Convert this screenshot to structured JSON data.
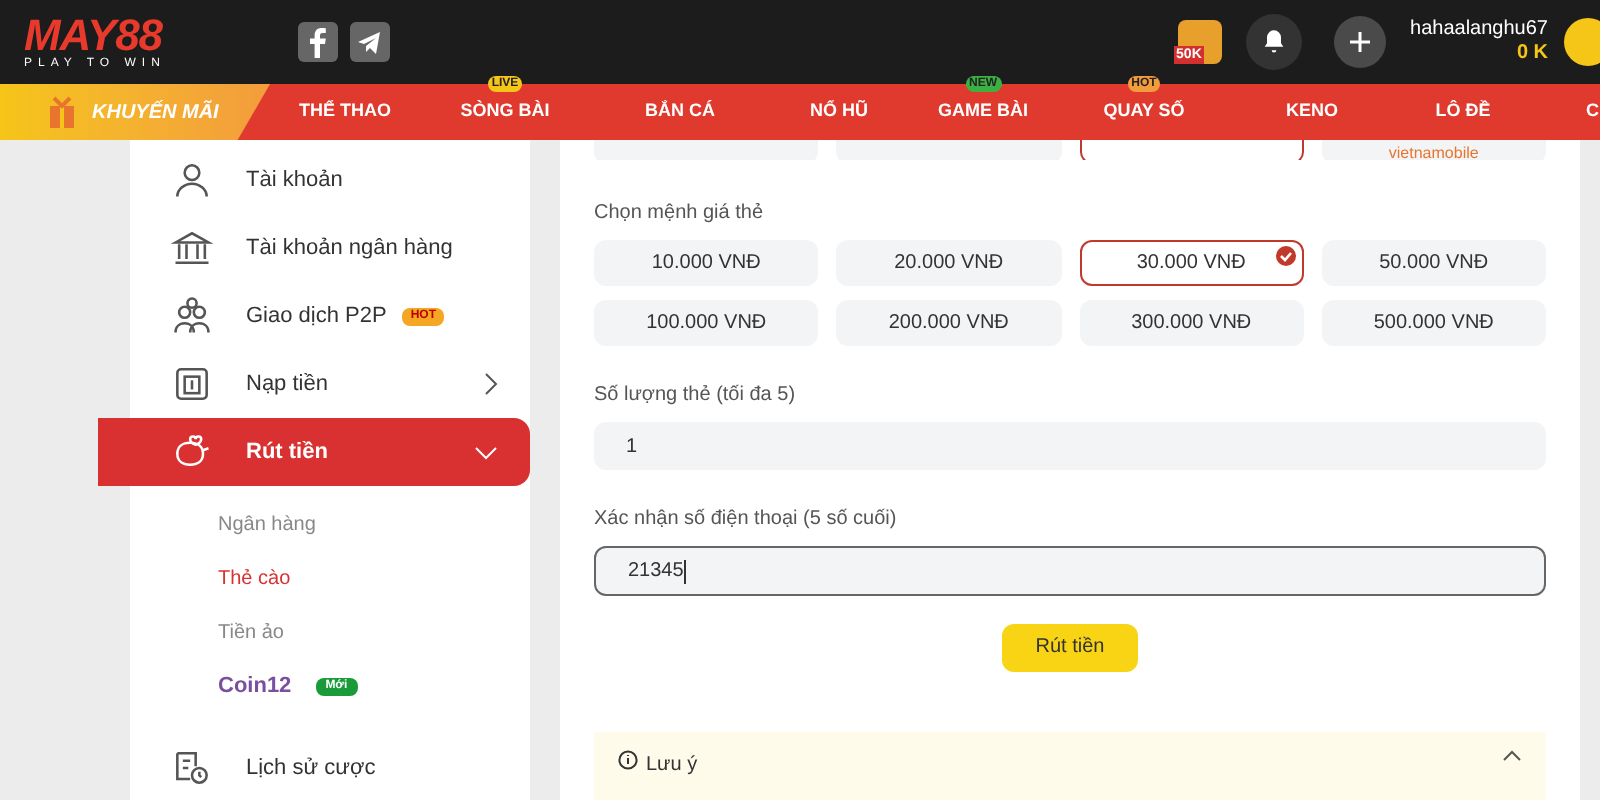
{
  "logo": {
    "name": "MAY88",
    "tagline": "PLAY TO WIN"
  },
  "header": {
    "username": "hahaalanghu67",
    "balance": "0 K",
    "promo_badge": "50K"
  },
  "nav": [
    {
      "label": "KHUYẾN MÃI",
      "kind": "promo"
    },
    {
      "label": "THỂ THAO",
      "kind": "link"
    },
    {
      "label": "SÒNG BÀI",
      "kind": "link",
      "tag": "LIVE",
      "color": "#f5c518"
    },
    {
      "label": "BẮN CÁ",
      "kind": "link"
    },
    {
      "label": "NỔ HŨ",
      "kind": "link"
    },
    {
      "label": "GAME BÀI",
      "kind": "link",
      "tag": "NEW",
      "color": "#3cb043"
    },
    {
      "label": "QUAY SỐ",
      "kind": "link",
      "tag": "HOT",
      "color": "#f39c3c"
    },
    {
      "label": "KENO",
      "kind": "link"
    },
    {
      "label": "LÔ ĐỀ",
      "kind": "link"
    },
    {
      "label": "C",
      "kind": "link"
    }
  ],
  "sidebar": {
    "items": [
      {
        "label": "Tài khoản",
        "selected": false
      },
      {
        "label": "Tài khoản ngân hàng",
        "selected": false
      },
      {
        "label": "Giao dịch P2P",
        "badge": "HOT",
        "selected": false
      },
      {
        "label": "Nạp tiền",
        "expanded": false,
        "selected": false
      },
      {
        "label": "Rút tiền",
        "expanded": true,
        "selected": true,
        "children": [
          {
            "label": "Ngân hàng",
            "selected": false
          },
          {
            "label": "Thẻ cào",
            "selected": true
          },
          {
            "label": "Tiền ảo",
            "selected": false
          },
          {
            "label": "Coin12",
            "badge": "Mới",
            "kind": "brand",
            "selected": false
          }
        ]
      },
      {
        "label": "Lịch sử cược",
        "selected": false
      }
    ]
  },
  "carriers": [
    {
      "selected": false
    },
    {
      "selected": false
    },
    {
      "selected": true
    },
    {
      "label": "vietnamobile",
      "selected": false
    }
  ],
  "denomination": {
    "label": "Chọn mệnh giá thẻ",
    "options": [
      {
        "label": "10.000 VNĐ",
        "selected": false
      },
      {
        "label": "20.000 VNĐ",
        "selected": false
      },
      {
        "label": "30.000 VNĐ",
        "selected": true
      },
      {
        "label": "50.000 VNĐ",
        "selected": false
      },
      {
        "label": "100.000 VNĐ",
        "selected": false
      },
      {
        "label": "200.000 VNĐ",
        "selected": false
      },
      {
        "label": "300.000 VNĐ",
        "selected": false
      },
      {
        "label": "500.000 VNĐ",
        "selected": false
      }
    ]
  },
  "quantity": {
    "label": "Số lượng thẻ (tối đa 5)",
    "value": "1",
    "focused": false
  },
  "phone": {
    "label": "Xác nhận số điện thoại (5 số cuối)",
    "value": "21345",
    "focused": true
  },
  "submit": "Rút tiền",
  "note": {
    "title": "Lưu ý",
    "expanded": true
  }
}
